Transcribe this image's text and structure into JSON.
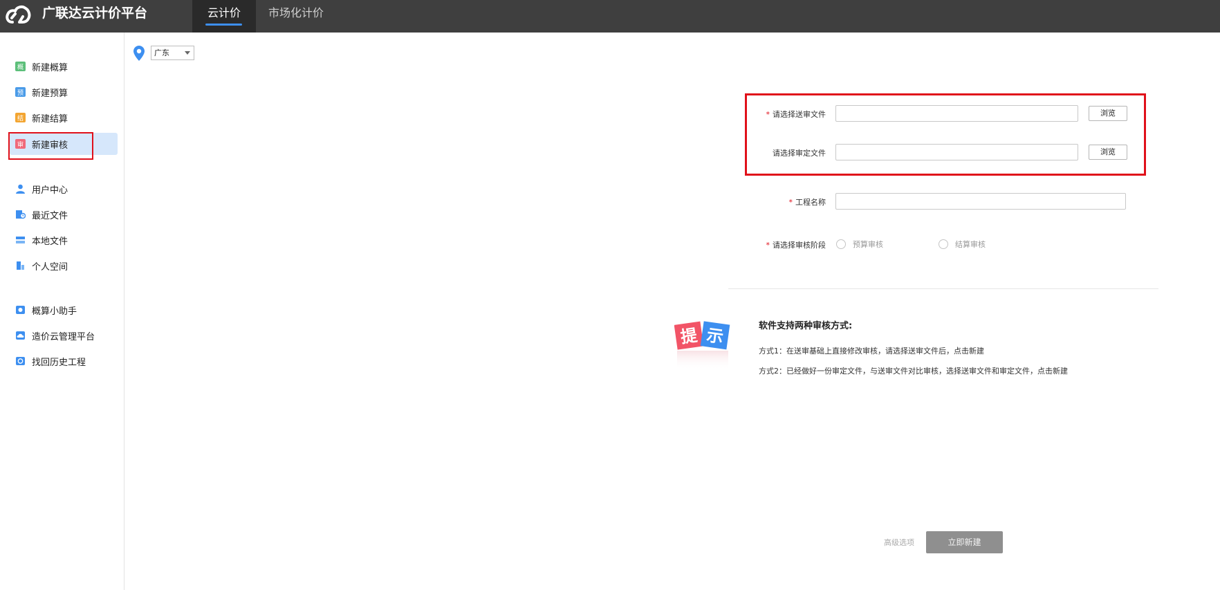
{
  "app": {
    "title": "广联达云计价平台"
  },
  "nav": {
    "tabs": [
      "云计价",
      "市场化计价"
    ],
    "active_index": 0
  },
  "sidebar": {
    "groups": [
      [
        {
          "label": "新建概算",
          "icon": "estimate-icon",
          "icon_char": "概",
          "color": "#5cbf7a"
        },
        {
          "label": "新建预算",
          "icon": "budget-icon",
          "icon_char": "预",
          "color": "#4a9be8"
        },
        {
          "label": "新建结算",
          "icon": "settlement-icon",
          "icon_char": "结",
          "color": "#f3a531"
        },
        {
          "label": "新建审核",
          "icon": "audit-icon",
          "icon_char": "审",
          "color": "#f06a7a",
          "active": true
        }
      ],
      [
        {
          "label": "用户中心",
          "icon": "user-icon"
        },
        {
          "label": "最近文件",
          "icon": "recent-files-icon"
        },
        {
          "label": "本地文件",
          "icon": "local-files-icon"
        },
        {
          "label": "个人空间",
          "icon": "personal-space-icon"
        }
      ],
      [
        {
          "label": "概算小助手",
          "icon": "assistant-icon"
        },
        {
          "label": "造价云管理平台",
          "icon": "cloud-platform-icon"
        },
        {
          "label": "找回历史工程",
          "icon": "history-icon"
        }
      ]
    ]
  },
  "region": {
    "selected": "广东"
  },
  "form": {
    "submit_file": {
      "label": "请选择送审文件",
      "required": true,
      "value": "",
      "button": "浏览"
    },
    "approved_file": {
      "label": "请选择审定文件",
      "required": false,
      "value": "",
      "button": "浏览"
    },
    "project_name": {
      "label": "工程名称",
      "required": true,
      "value": ""
    },
    "stage": {
      "label": "请选择审核阶段",
      "required": true,
      "options": [
        "预算审核",
        "结算审核"
      ]
    }
  },
  "tips": {
    "badge": [
      "提",
      "示"
    ],
    "heading": "软件支持两种审核方式:",
    "lines": [
      "方式1：在送审基础上直接修改审核，请选择送审文件后，点击新建",
      "方式2：已经做好一份审定文件，与送审文件对比审核，选择送审文件和审定文件，点击新建"
    ]
  },
  "footer": {
    "advanced": "高级选项",
    "create": "立即新建"
  }
}
